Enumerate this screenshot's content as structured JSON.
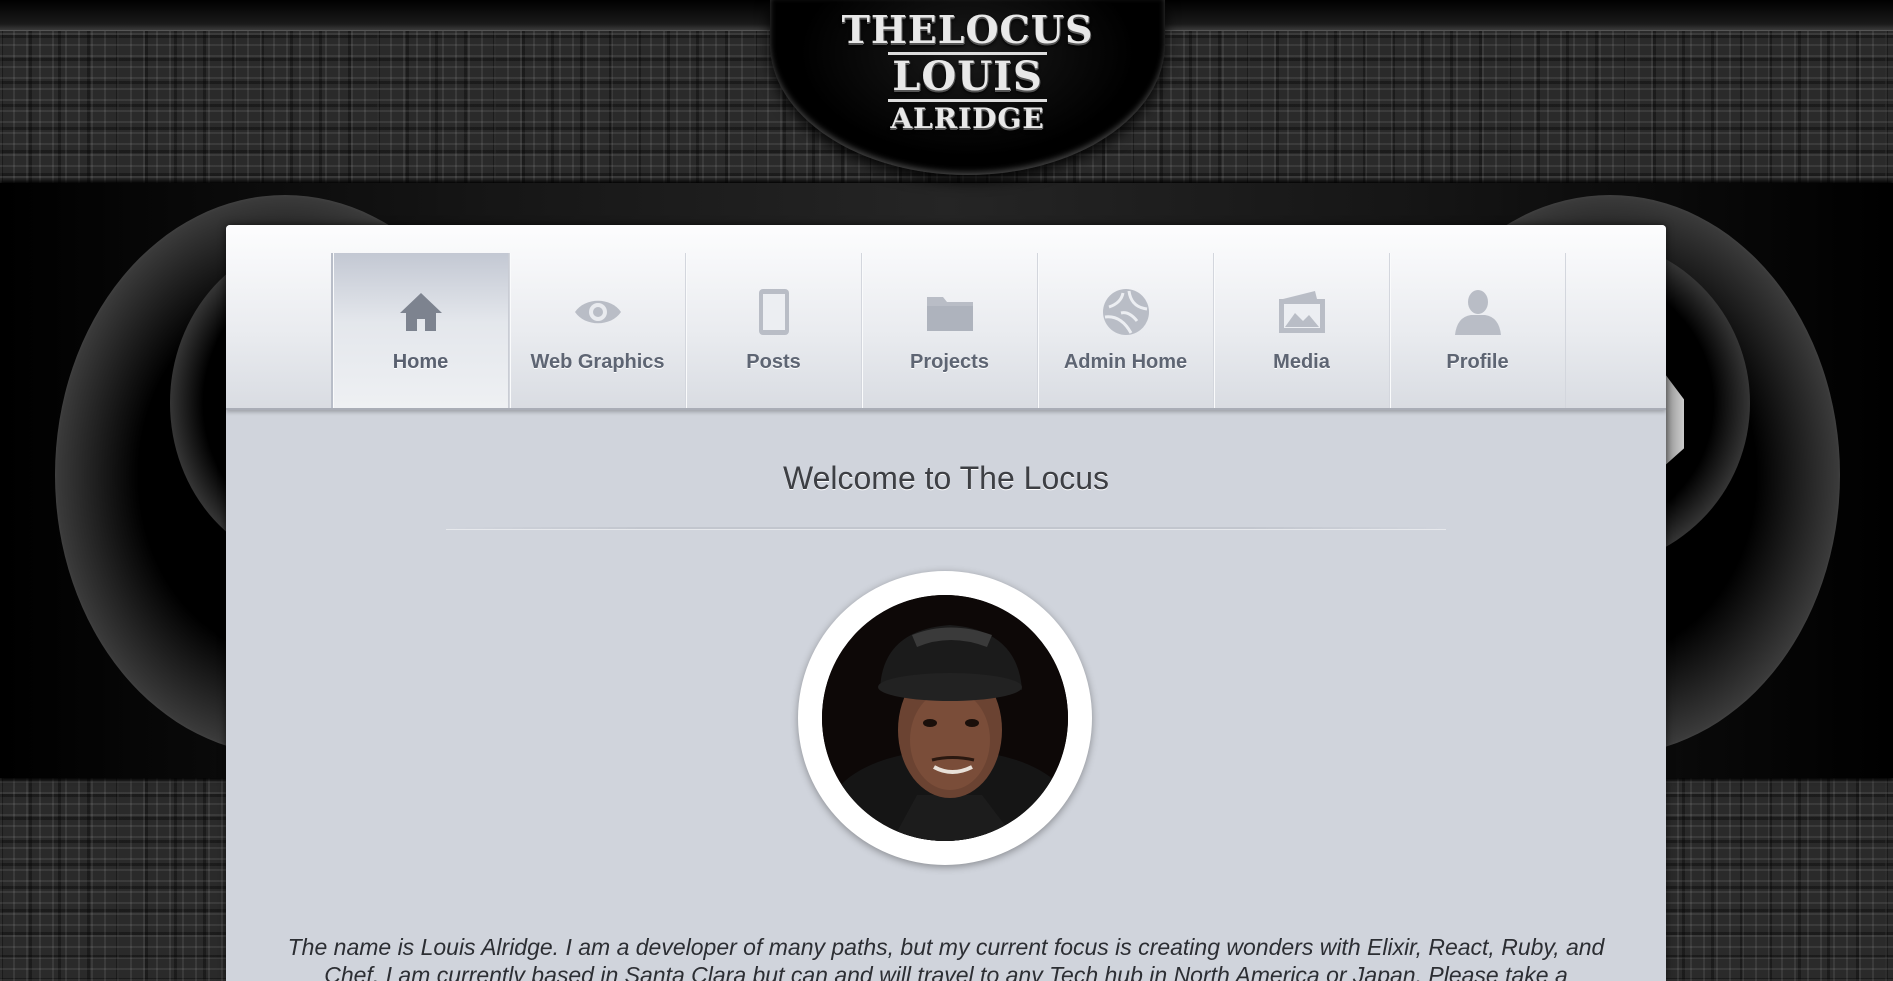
{
  "logo": {
    "line1": "THELOCUS",
    "line2": "LOUIS",
    "line3": "ALRIDGE"
  },
  "nav": {
    "items": [
      {
        "label": "Home",
        "icon": "home-icon",
        "active": true
      },
      {
        "label": "Web Graphics",
        "icon": "eye-icon",
        "active": false
      },
      {
        "label": "Posts",
        "icon": "tablet-icon",
        "active": false
      },
      {
        "label": "Projects",
        "icon": "folder-icon",
        "active": false
      },
      {
        "label": "Admin Home",
        "icon": "globe-icon",
        "active": false
      },
      {
        "label": "Media",
        "icon": "picture-icon",
        "active": false
      },
      {
        "label": "Profile",
        "icon": "user-icon",
        "active": false
      }
    ]
  },
  "main": {
    "title": "Welcome to The Locus",
    "bio": "The name is Louis Alridge. I am a developer of many paths, but my current focus is creating wonders with Elixir, React, Ruby, and Chef. I am currently based in Santa Clara but can and will travel to any Tech hub in North America or Japan. Please take a"
  },
  "colors": {
    "panel": "#d0d4dc",
    "nav_text": "#5e6573",
    "icon": "#7d838f"
  }
}
